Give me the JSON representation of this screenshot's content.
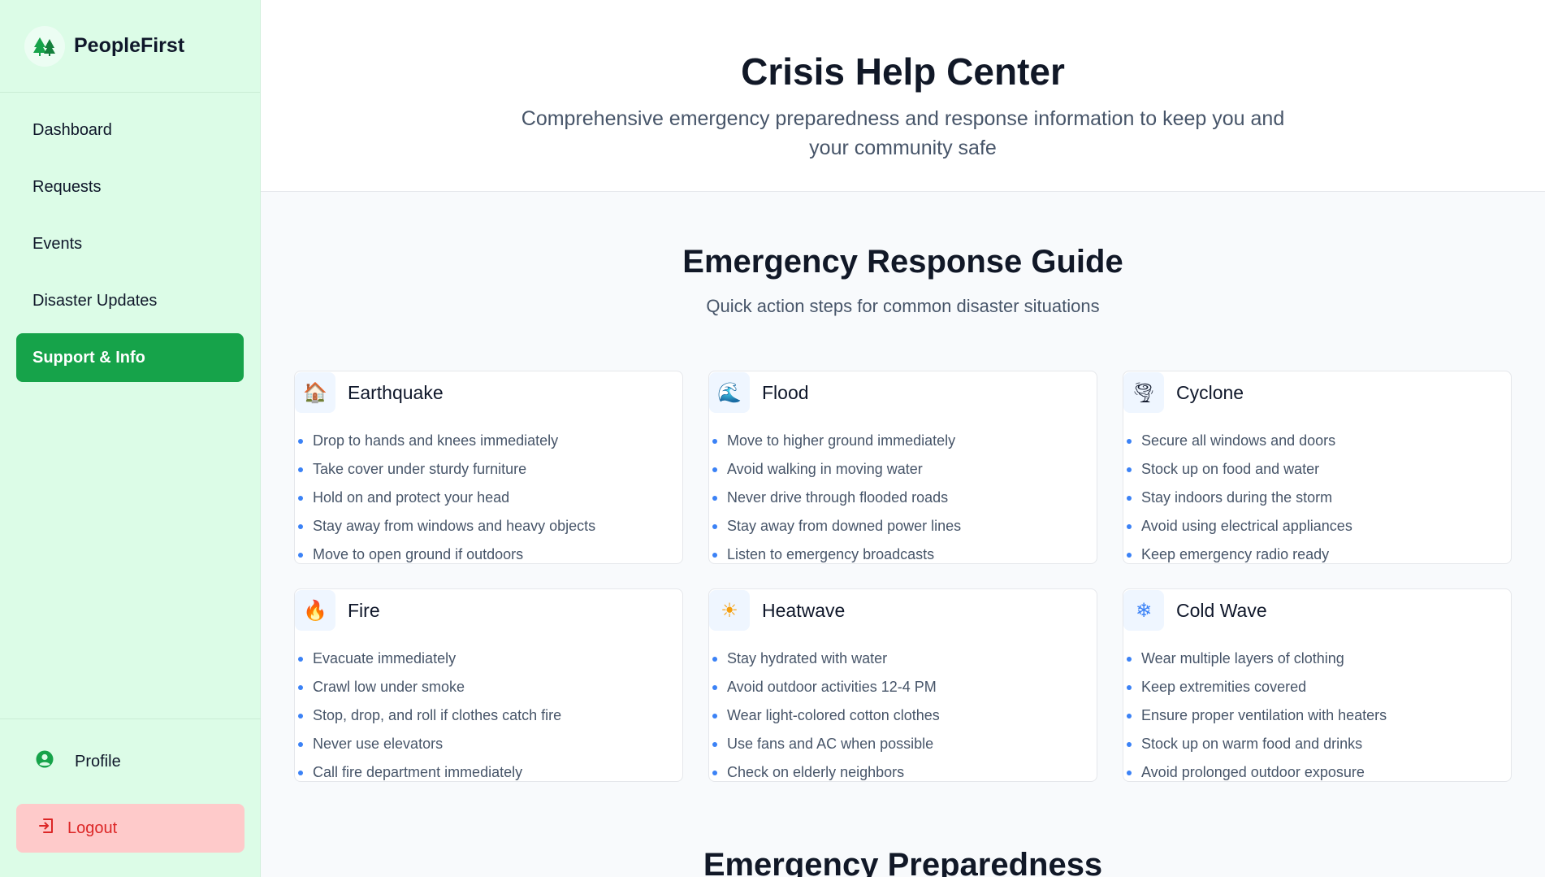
{
  "sidebar": {
    "brand": "PeopleFirst",
    "nav": [
      {
        "label": "Dashboard",
        "active": false
      },
      {
        "label": "Requests",
        "active": false
      },
      {
        "label": "Events",
        "active": false
      },
      {
        "label": "Disaster Updates",
        "active": false
      },
      {
        "label": "Support & Info",
        "active": true
      }
    ],
    "profile_label": "Profile",
    "logout_label": "Logout"
  },
  "hero": {
    "title": "Crisis Help Center",
    "subtitle": "Comprehensive emergency preparedness and response information to keep you and your community safe"
  },
  "guide": {
    "title": "Emergency Response Guide",
    "subtitle": "Quick action steps for common disaster situations",
    "cards": [
      {
        "icon": "🏠",
        "icon_name": "house-icon",
        "title": "Earthquake",
        "steps": [
          "Drop to hands and knees immediately",
          "Take cover under sturdy furniture",
          "Hold on and protect your head",
          "Stay away from windows and heavy objects",
          "Move to open ground if outdoors"
        ]
      },
      {
        "icon": "🌊",
        "icon_name": "wave-icon",
        "title": "Flood",
        "steps": [
          "Move to higher ground immediately",
          "Avoid walking in moving water",
          "Never drive through flooded roads",
          "Stay away from downed power lines",
          "Listen to emergency broadcasts"
        ]
      },
      {
        "icon": "🌪",
        "icon_name": "tornado-icon",
        "title": "Cyclone",
        "steps": [
          "Secure all windows and doors",
          "Stock up on food and water",
          "Stay indoors during the storm",
          "Avoid using electrical appliances",
          "Keep emergency radio ready"
        ]
      },
      {
        "icon": "🔥",
        "icon_name": "fire-icon",
        "title": "Fire",
        "steps": [
          "Evacuate immediately",
          "Crawl low under smoke",
          "Stop, drop, and roll if clothes catch fire",
          "Never use elevators",
          "Call fire department immediately"
        ]
      },
      {
        "icon": "☀",
        "icon_name": "sun-icon",
        "title": "Heatwave",
        "steps": [
          "Stay hydrated with water",
          "Avoid outdoor activities 12-4 PM",
          "Wear light-colored cotton clothes",
          "Use fans and AC when possible",
          "Check on elderly neighbors"
        ]
      },
      {
        "icon": "❄",
        "icon_name": "snowflake-icon",
        "title": "Cold Wave",
        "steps": [
          "Wear multiple layers of clothing",
          "Keep extremities covered",
          "Ensure proper ventilation with heaters",
          "Stock up on warm food and drinks",
          "Avoid prolonged outdoor exposure"
        ]
      }
    ]
  },
  "next_section_title": "Emergency Preparedness",
  "colors": {
    "accent": "#16a34a",
    "sidebar_bg": "#dcfce7",
    "logout_bg": "#fecaca",
    "bullet": "#3b82f6"
  }
}
